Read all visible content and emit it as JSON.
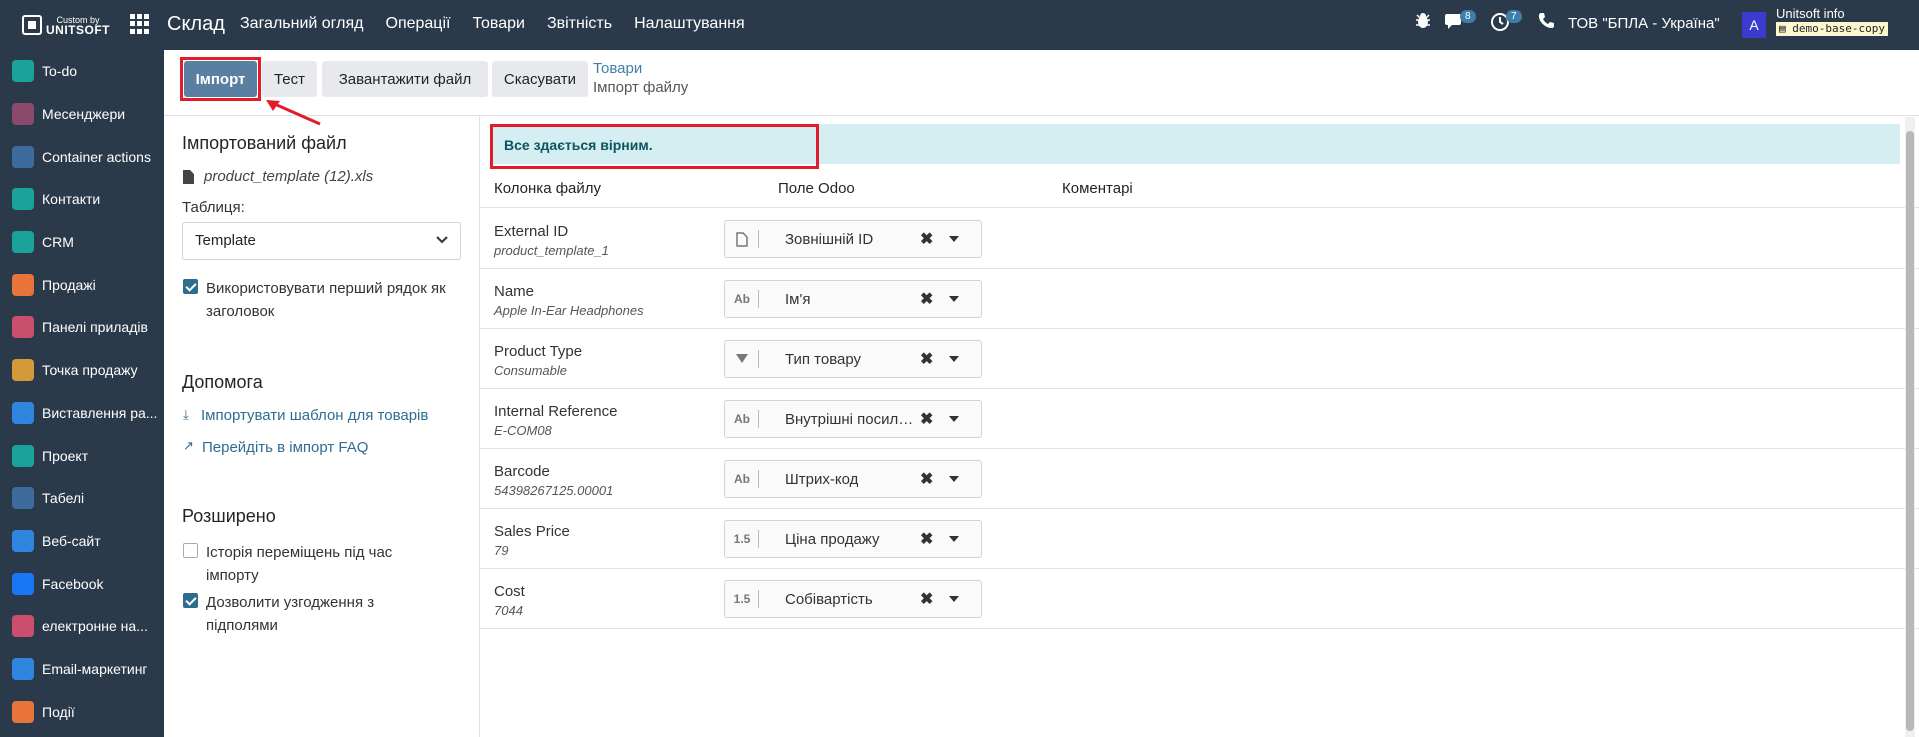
{
  "topbar": {
    "logo_small": "Custom by",
    "logo_big": "UNITSOFT",
    "app_title": "Склад",
    "menu": [
      "Загальний огляд",
      "Операції",
      "Товари",
      "Звітність",
      "Налаштування"
    ],
    "messages_count": "8",
    "activities_count": "7",
    "company": "ТОВ \"БПЛА - Україна\"",
    "avatar_letter": "A",
    "user_name": "Unitsoft info",
    "db_name": "demo-base-copy"
  },
  "sidebar": {
    "items": [
      {
        "label": "To-do",
        "icon": "todo-icon",
        "color": "#1aa39a"
      },
      {
        "label": "Месенджери",
        "icon": "messenger-icon",
        "color": "#8b4a6b"
      },
      {
        "label": "Container actions",
        "icon": "container-icon",
        "color": "#3d6b9e"
      },
      {
        "label": "Контакти",
        "icon": "contacts-icon",
        "color": "#1aa39a"
      },
      {
        "label": "CRM",
        "icon": "crm-icon",
        "color": "#1aa39a"
      },
      {
        "label": "Продажі",
        "icon": "sales-icon",
        "color": "#e8743b"
      },
      {
        "label": "Панелі приладів",
        "icon": "dashboard-icon",
        "color": "#c94f6d"
      },
      {
        "label": "Точка продажу",
        "icon": "pos-icon",
        "color": "#d49a3a"
      },
      {
        "label": "Виставлення ра...",
        "icon": "invoice-icon",
        "color": "#2e86de"
      },
      {
        "label": "Проект",
        "icon": "project-icon",
        "color": "#1aa39a"
      },
      {
        "label": "Табелі",
        "icon": "timesheet-icon",
        "color": "#3d6b9e"
      },
      {
        "label": "Веб-сайт",
        "icon": "website-icon",
        "color": "#2e86de"
      },
      {
        "label": "Facebook",
        "icon": "facebook-icon",
        "color": "#1877f2"
      },
      {
        "label": "електронне на...",
        "icon": "elearning-icon",
        "color": "#c94f6d"
      },
      {
        "label": "Email-маркетинг",
        "icon": "email-icon",
        "color": "#2e86de"
      },
      {
        "label": "Події",
        "icon": "events-icon",
        "color": "#e8743b"
      }
    ]
  },
  "control_panel": {
    "import_button": "Імпорт",
    "test_button": "Тест",
    "upload_button": "Завантажити файл",
    "cancel_button": "Скасувати",
    "breadcrumb_parent": "Товари",
    "breadcrumb_current": "Імпорт файлу"
  },
  "left": {
    "imported_file_title": "Імпортований файл",
    "file_name": "product_template (12).xls",
    "table_label": "Таблиця:",
    "table_value": "Template",
    "use_header_label": "Використовувати перший рядок як заголовок",
    "use_header_checked": true,
    "help_title": "Допомога",
    "help_link1": "Імпортувати шаблон для товарів",
    "help_link2": "Перейдіть в імпорт FAQ",
    "advanced_title": "Розширено",
    "opt1_label": "Історія переміщень під час імпорту",
    "opt1_checked": false,
    "opt2_label": "Дозволити узгодження з підполями",
    "opt2_checked": true
  },
  "right": {
    "alert": "Все здається вірним.",
    "col_file": "Колонка файлу",
    "col_odoo": "Поле Odoo",
    "col_comment": "Коментарі",
    "rows": [
      {
        "name": "External ID",
        "sample": "product_template_1",
        "type": "doc",
        "field": "Зовнішній ID"
      },
      {
        "name": "Name",
        "sample": "Apple In-Ear Headphones",
        "type": "Ab",
        "field": "Ім'я"
      },
      {
        "name": "Product Type",
        "sample": "Consumable",
        "type": "sel",
        "field": "Тип товару"
      },
      {
        "name": "Internal Reference",
        "sample": "E-COM08",
        "type": "Ab",
        "field": "Внутрішні посилання"
      },
      {
        "name": "Barcode",
        "sample": "54398267125.00001",
        "type": "Ab",
        "field": "Штрих-код"
      },
      {
        "name": "Sales Price",
        "sample": "79",
        "type": "1.5",
        "field": "Ціна продажу"
      },
      {
        "name": "Cost",
        "sample": "7044",
        "type": "1.5",
        "field": "Собівартість"
      }
    ]
  }
}
